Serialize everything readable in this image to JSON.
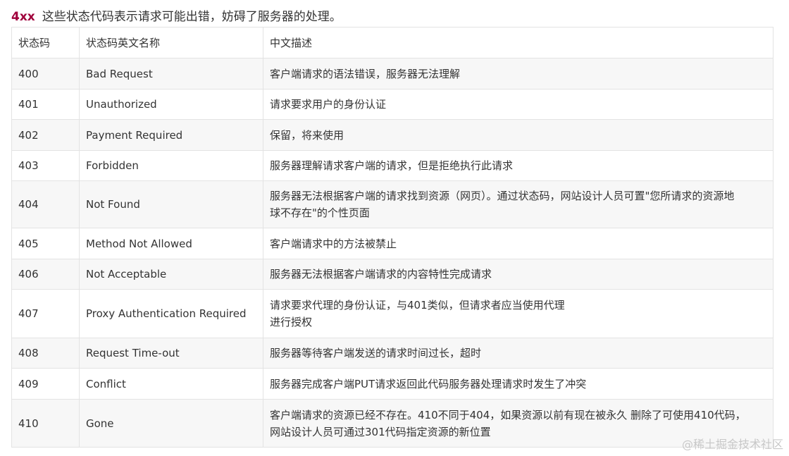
{
  "heading": {
    "code": "4xx",
    "text": "这些状态代码表示请求可能出错，妨碍了服务器的处理。"
  },
  "table": {
    "headers": [
      "状态码",
      "状态码英文名称",
      "中文描述"
    ],
    "rows": [
      {
        "code": "400",
        "name": "Bad Request",
        "desc": [
          "客户端请求的语法错误，服务器无法理解"
        ]
      },
      {
        "code": "401",
        "name": "Unauthorized",
        "desc": [
          "请求要求用户的身份认证"
        ]
      },
      {
        "code": "402",
        "name": "Payment Required",
        "desc": [
          "保留，将来使用"
        ]
      },
      {
        "code": "403",
        "name": "Forbidden",
        "desc": [
          "服务器理解请求客户端的请求，但是拒绝执行此请求"
        ]
      },
      {
        "code": "404",
        "name": "Not Found",
        "desc": [
          "服务器无法根据客户端的请求找到资源（网页）。通过状态码，网站设计人员可置\"您所请求的资源地",
          "球不存在\"的个性页面"
        ]
      },
      {
        "code": "405",
        "name": "Method Not Allowed",
        "desc": [
          "客户端请求中的方法被禁止"
        ]
      },
      {
        "code": "406",
        "name": "Not Acceptable",
        "desc": [
          "服务器无法根据客户端请求的内容特性完成请求"
        ]
      },
      {
        "code": "407",
        "name": "Proxy Authentication Required",
        "desc": [
          "请求要求代理的身份认证，与401类似，但请求者应当使用代理",
          "进行授权"
        ]
      },
      {
        "code": "408",
        "name": "Request Time-out",
        "desc": [
          "服务器等待客户端发送的请求时间过长，超时"
        ]
      },
      {
        "code": "409",
        "name": "Conflict",
        "desc": [
          "服务器完成客户端PUT请求返回此代码服务器处理请求时发生了冲突"
        ]
      },
      {
        "code": "410",
        "name": "Gone",
        "desc": [
          "客户端请求的资源已经不存在。410不同于404，如果资源以前有现在被永久 删除了可使用410代码，",
          "网站设计人员可通过301代码指定资源的新位置"
        ]
      }
    ]
  },
  "watermark": "@稀土掘金技术社区"
}
